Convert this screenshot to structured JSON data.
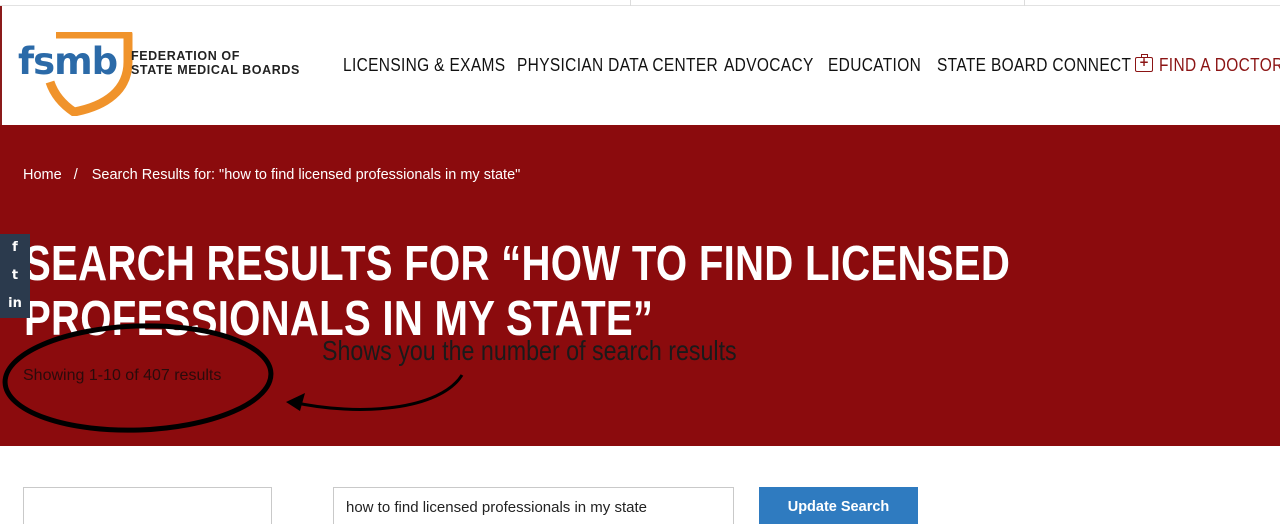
{
  "logo": {
    "wordmark": "fsmb",
    "org_line1": "FEDERATION OF",
    "org_line2": "STATE MEDICAL BOARDS",
    "shield_color": "#f0932b",
    "wordmark_color": "#2b6aa8"
  },
  "nav": {
    "items": [
      {
        "label": "LICENSING & EXAMS"
      },
      {
        "label": "PHYSICIAN DATA CENTER"
      },
      {
        "label": "ADVOCACY"
      },
      {
        "label": "EDUCATION"
      },
      {
        "label": "STATE BOARD CONNECT"
      }
    ],
    "find_doctor": {
      "label": "FIND A DOCTOR",
      "icon": "medical-kit-icon"
    }
  },
  "breadcrumb": {
    "home": "Home",
    "separator": "/",
    "current": "Search Results for: \"how to find licensed professionals in my state\""
  },
  "page_title": "SEARCH RESULTS FOR “HOW TO FIND LICENSED PROFESSIONALS IN MY STATE”",
  "result_count": "Showing 1-10 of 407 results",
  "annotation": {
    "text": "Shows you the number of search results"
  },
  "social": [
    {
      "glyph": "f",
      "icon": "facebook-icon"
    },
    {
      "glyph": "t",
      "icon": "twitter-icon"
    },
    {
      "glyph": "in",
      "icon": "linkedin-icon"
    }
  ],
  "search": {
    "query": "how to find licensed professionals in my state",
    "button_label": "Update Search"
  },
  "colors": {
    "banner": "#8b0b0d",
    "accent_red": "#8b1414",
    "button_blue": "#2f7bc0"
  }
}
